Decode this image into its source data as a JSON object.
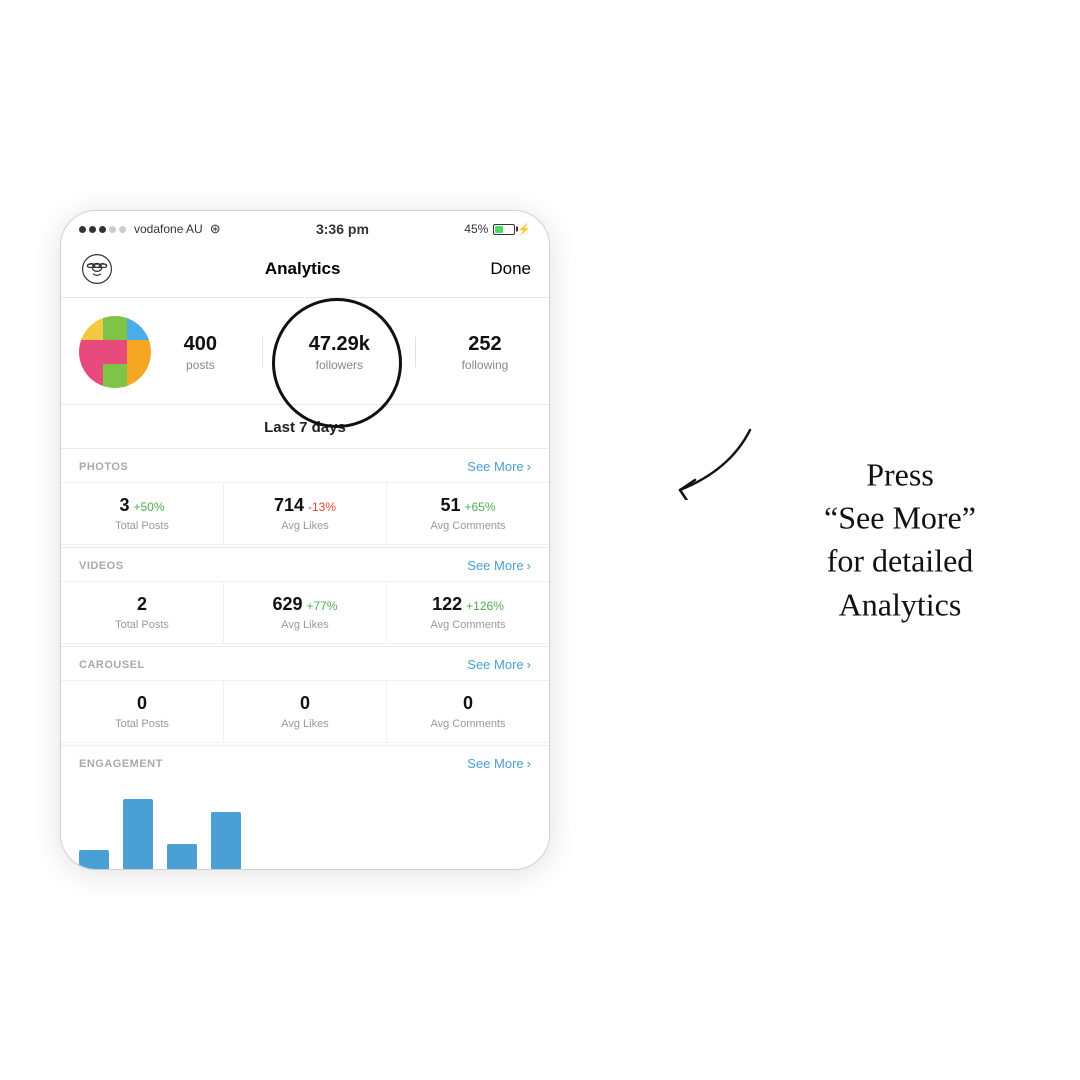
{
  "statusBar": {
    "carrier": "vodafone AU",
    "time": "3:36 pm",
    "battery": "45%",
    "signal_dots": [
      true,
      true,
      true,
      false,
      false
    ]
  },
  "nav": {
    "title": "Analytics",
    "done_label": "Done"
  },
  "profile": {
    "posts_count": "400",
    "posts_label": "posts",
    "followers_count": "47.29k",
    "followers_label": "followers",
    "following_count": "252",
    "following_label": "following"
  },
  "period_label": "Last 7 days",
  "sections": [
    {
      "id": "photos",
      "title": "PHOTOS",
      "see_more": "See More",
      "metrics": [
        {
          "value": "3",
          "change": "+50%",
          "change_type": "pos",
          "label": "Total Posts"
        },
        {
          "value": "714",
          "change": "-13%",
          "change_type": "neg",
          "label": "Avg Likes"
        },
        {
          "value": "51",
          "change": "+65%",
          "change_type": "pos",
          "label": "Avg Comments"
        }
      ]
    },
    {
      "id": "videos",
      "title": "VIDEOS",
      "see_more": "See More",
      "metrics": [
        {
          "value": "2",
          "change": "",
          "change_type": "",
          "label": "Total Posts"
        },
        {
          "value": "629",
          "change": "+77%",
          "change_type": "pos",
          "label": "Avg Likes"
        },
        {
          "value": "122",
          "change": "+126%",
          "change_type": "pos",
          "label": "Avg Comments"
        }
      ]
    },
    {
      "id": "carousel",
      "title": "CAROUSEL",
      "see_more": "See More",
      "metrics": [
        {
          "value": "0",
          "change": "",
          "change_type": "",
          "label": "Total Posts"
        },
        {
          "value": "0",
          "change": "",
          "change_type": "",
          "label": "Avg Likes"
        },
        {
          "value": "0",
          "change": "",
          "change_type": "",
          "label": "Avg Comments"
        }
      ]
    }
  ],
  "engagement": {
    "title": "ENGAGEMENT",
    "see_more": "See More"
  },
  "bars": [
    15,
    55,
    20,
    45
  ],
  "annotation": {
    "line1": "Press",
    "line2": "“See More”",
    "line3": "for detailed",
    "line4": "Analytics"
  },
  "avatar_colors": [
    "#f5c842",
    "#7dc447",
    "#4aace8",
    "#e84a7e",
    "#e84a7e",
    "#f5a623",
    "#e84a7e",
    "#7dc447",
    "#f5a623"
  ]
}
